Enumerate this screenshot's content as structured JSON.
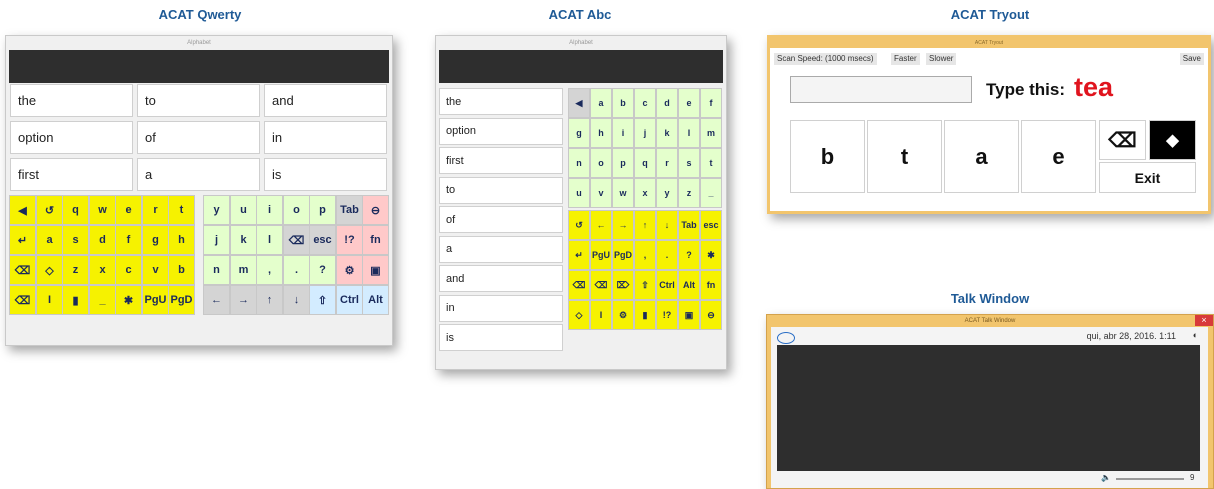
{
  "titles": {
    "qwerty": "ACAT Qwerty",
    "abc": "ACAT Abc",
    "tryout": "ACAT Tryout",
    "talk": "Talk Window"
  },
  "qwerty": {
    "window_title": "Alphabet",
    "words": [
      "the",
      "to",
      "and",
      "option",
      "of",
      "in",
      "first",
      "a",
      "is"
    ],
    "rows": [
      [
        [
          "◀",
          "Y"
        ],
        [
          "↺",
          "Y"
        ],
        [
          "q",
          "Y"
        ],
        [
          "w",
          "Y"
        ],
        [
          "e",
          "Y"
        ],
        [
          "r",
          "Y"
        ],
        [
          "t",
          "Y"
        ],
        [
          "y",
          "G"
        ],
        [
          "u",
          "G"
        ],
        [
          "i",
          "G"
        ],
        [
          "o",
          "G"
        ],
        [
          "p",
          "G"
        ],
        [
          "Tab",
          "D"
        ],
        [
          "⊖",
          "R"
        ]
      ],
      [
        [
          "↵",
          "Y"
        ],
        [
          "a",
          "Y"
        ],
        [
          "s",
          "Y"
        ],
        [
          "d",
          "Y"
        ],
        [
          "f",
          "Y"
        ],
        [
          "g",
          "Y"
        ],
        [
          "h",
          "Y"
        ],
        [
          "j",
          "G"
        ],
        [
          "k",
          "G"
        ],
        [
          "l",
          "G"
        ],
        [
          "⌫",
          "D"
        ],
        [
          "esc",
          "D"
        ],
        [
          "!?",
          "R"
        ],
        [
          "fn",
          "R"
        ]
      ],
      [
        [
          "⌫",
          "Y"
        ],
        [
          "◇",
          "Y"
        ],
        [
          "z",
          "Y"
        ],
        [
          "x",
          "Y"
        ],
        [
          "c",
          "Y"
        ],
        [
          "v",
          "Y"
        ],
        [
          "b",
          "Y"
        ],
        [
          "n",
          "G"
        ],
        [
          "m",
          "G"
        ],
        [
          ",",
          "G"
        ],
        [
          ".",
          "G"
        ],
        [
          "?",
          "G"
        ],
        [
          "⚙",
          "R"
        ],
        [
          "▣",
          "R"
        ]
      ],
      [
        [
          "⌫",
          "Y"
        ],
        [
          "I",
          "Y"
        ],
        [
          "▮",
          "Y"
        ],
        [
          "_",
          "Y"
        ],
        [
          "✱",
          "Y"
        ],
        [
          "PgU",
          "Y"
        ],
        [
          "PgD",
          "Y"
        ],
        [
          "←",
          "D"
        ],
        [
          "→",
          "D"
        ],
        [
          "↑",
          "D"
        ],
        [
          "↓",
          "D"
        ],
        [
          "⇧",
          "B"
        ],
        [
          "Ctrl",
          "B"
        ],
        [
          "Alt",
          "B"
        ]
      ]
    ]
  },
  "abc": {
    "window_title": "Alphabet",
    "words": [
      "the",
      "option",
      "first",
      "to",
      "of",
      "a",
      "and",
      "in",
      "is"
    ],
    "rows": [
      [
        [
          "◀",
          "D"
        ],
        [
          "a",
          "G"
        ],
        [
          "b",
          "G"
        ],
        [
          "c",
          "G"
        ],
        [
          "d",
          "G"
        ],
        [
          "e",
          "G"
        ],
        [
          "f",
          "G"
        ]
      ],
      [
        [
          "g",
          "G"
        ],
        [
          "h",
          "G"
        ],
        [
          "i",
          "G"
        ],
        [
          "j",
          "G"
        ],
        [
          "k",
          "G"
        ],
        [
          "l",
          "G"
        ],
        [
          "m",
          "G"
        ]
      ],
      [
        [
          "n",
          "G"
        ],
        [
          "o",
          "G"
        ],
        [
          "p",
          "G"
        ],
        [
          "q",
          "G"
        ],
        [
          "r",
          "G"
        ],
        [
          "s",
          "G"
        ],
        [
          "t",
          "G"
        ]
      ],
      [
        [
          "u",
          "G"
        ],
        [
          "v",
          "G"
        ],
        [
          "w",
          "G"
        ],
        [
          "x",
          "G"
        ],
        [
          "y",
          "G"
        ],
        [
          "z",
          "G"
        ],
        [
          "_",
          "G"
        ]
      ],
      [
        [
          "↺",
          "Y"
        ],
        [
          "←",
          "Y"
        ],
        [
          "→",
          "Y"
        ],
        [
          "↑",
          "Y"
        ],
        [
          "↓",
          "Y"
        ],
        [
          "Tab",
          "Y"
        ],
        [
          "esc",
          "Y"
        ]
      ],
      [
        [
          "↵",
          "Y"
        ],
        [
          "PgU",
          "Y"
        ],
        [
          "PgD",
          "Y"
        ],
        [
          ",",
          "Y"
        ],
        [
          ".",
          "Y"
        ],
        [
          "?",
          "Y"
        ],
        [
          "✱",
          "Y"
        ]
      ],
      [
        [
          "⌫",
          "Y"
        ],
        [
          "⌫",
          "Y"
        ],
        [
          "⌦",
          "Y"
        ],
        [
          "⇧",
          "Y"
        ],
        [
          "Ctrl",
          "Y"
        ],
        [
          "Alt",
          "Y"
        ],
        [
          "fn",
          "Y"
        ]
      ],
      [
        [
          "◇",
          "Y"
        ],
        [
          "I",
          "Y"
        ],
        [
          "⚙",
          "Y"
        ],
        [
          "▮",
          "Y"
        ],
        [
          "!?",
          "Y"
        ],
        [
          "▣",
          "Y"
        ],
        [
          "⊖",
          "Y"
        ]
      ]
    ]
  },
  "tryout": {
    "window_title": "ACAT Tryout",
    "scan_speed": "Scan Speed:",
    "scan_value": "(1000 msecs)",
    "faster": "Faster",
    "slower": "Slower",
    "save": "Save",
    "prompt": "Type this:",
    "target": "tea",
    "keys": [
      "b",
      "t",
      "a",
      "e"
    ],
    "backspace": "⌫",
    "erase": "⬥",
    "exit": "Exit"
  },
  "talk": {
    "window_title": "ACAT Talk Window",
    "datetime": "qui, abr 28, 2016. 1:11",
    "volume": "🔈",
    "volume_value": "9",
    "close": "×"
  },
  "colors": {
    "yellow": "#f6f200",
    "green": "#e4ffcc",
    "grey": "#d4d4d4",
    "pink": "#ffc9c9",
    "blue": "#d3ecff",
    "title_blue": "#1f5a96",
    "target_red": "#e0141e",
    "talk_frame": "#f2c56d"
  }
}
